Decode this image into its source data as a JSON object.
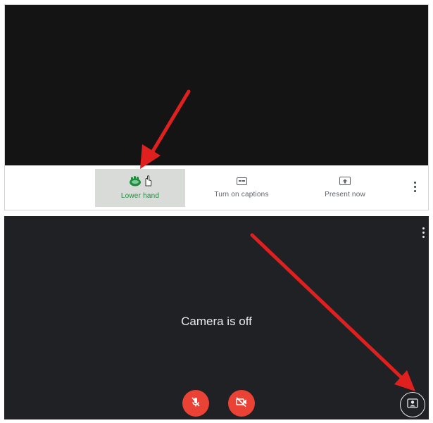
{
  "toolbar": {
    "raise_hand_label": "Lower hand",
    "captions_label": "Turn on captions",
    "present_label": "Present now"
  },
  "call": {
    "status_text": "Camera is off"
  },
  "icons": {
    "raise_hand": "hand-icon",
    "cursor": "pointer-cursor-icon",
    "captions": "captions-icon",
    "present": "present-icon",
    "more": "more-vert-icon",
    "mic": "mic-off-icon",
    "camera": "camera-off-icon",
    "self_view": "self-view-icon"
  },
  "colors": {
    "accent_green": "#1e8e3e",
    "hangup_red": "#ea4335",
    "annotation_arrow": "#e0201e",
    "video_background": "#202124"
  }
}
